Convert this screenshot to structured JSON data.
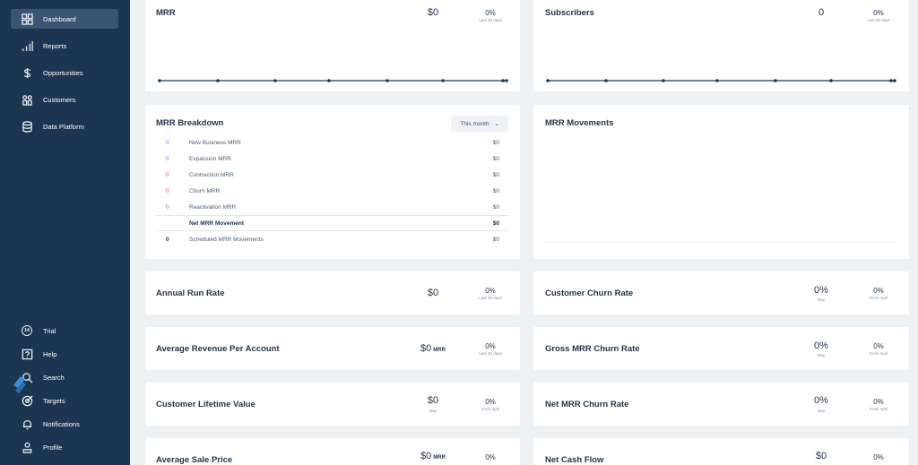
{
  "sidebar": {
    "top_items": [
      {
        "label": "Dashboard",
        "icon": "dashboard-icon",
        "active": true
      },
      {
        "label": "Reports",
        "icon": "bar-chart-icon"
      },
      {
        "label": "Opportunities",
        "icon": "dollar-icon"
      },
      {
        "label": "Customers",
        "icon": "customers-icon"
      },
      {
        "label": "Data Platform",
        "icon": "database-icon"
      }
    ],
    "bottom_items": [
      {
        "label": "Trial",
        "icon": "trial-badge-icon",
        "badge": "14"
      },
      {
        "label": "Help",
        "icon": "help-icon"
      },
      {
        "label": "Search",
        "icon": "search-icon"
      },
      {
        "label": "Targets",
        "icon": "target-icon"
      },
      {
        "label": "Notifications",
        "icon": "bell-icon"
      },
      {
        "label": "Profile",
        "icon": "user-icon"
      }
    ]
  },
  "cards": {
    "mrr": {
      "title": "MRR",
      "value": "$0",
      "pct": "0%",
      "pct_caption": "Last 30 days"
    },
    "subscribers": {
      "title": "Subscribers",
      "value": "0",
      "pct": "0%",
      "pct_caption": "Last 30 days"
    },
    "breakdown": {
      "title": "MRR Breakdown",
      "dropdown": "This month",
      "rows": [
        {
          "count": "0",
          "label": "New Business MRR",
          "amount": "$0"
        },
        {
          "count": "0",
          "label": "Expansion MRR",
          "amount": "$0"
        },
        {
          "count": "0",
          "label": "Contraction MRR",
          "amount": "$0"
        },
        {
          "count": "0",
          "label": "Churn MRR",
          "amount": "$0"
        },
        {
          "count": "0",
          "label": "Reactivation MRR",
          "amount": "$0"
        },
        {
          "count": "",
          "label": "Net MRR Movement",
          "amount": "$0"
        },
        {
          "count": "0",
          "label": "Scheduled MRR Movements",
          "amount": "$0"
        }
      ]
    },
    "movements": {
      "title": "MRR Movements"
    },
    "arr": {
      "title": "Annual Run Rate",
      "value": "$0",
      "pct": "0%",
      "pct_caption": "Last 30 days"
    },
    "cust_churn": {
      "title": "Customer Churn Rate",
      "value": "0%",
      "value_caption": "May",
      "pct": "0%",
      "pct_caption": "From April"
    },
    "arpa": {
      "title": "Average Revenue Per Account",
      "value": "$0",
      "unit": "MRR",
      "pct": "0%",
      "pct_caption": "Last 30 days"
    },
    "gross_churn": {
      "title": "Gross MRR Churn Rate",
      "value": "0%",
      "value_caption": "May",
      "pct": "0%",
      "pct_caption": "From April"
    },
    "ltv": {
      "title": "Customer Lifetime Value",
      "value": "$0",
      "value_caption": "May",
      "pct": "0%",
      "pct_caption": "From April"
    },
    "net_churn": {
      "title": "Net MRR Churn Rate",
      "value": "0%",
      "value_caption": "May",
      "pct": "0%",
      "pct_caption": "From April"
    },
    "asp": {
      "title": "Average Sale Price",
      "value": "$0",
      "unit": "MRR",
      "pct": "0%"
    },
    "cash_flow": {
      "title": "Net Cash Flow",
      "value": "$0",
      "pct": "0%"
    }
  },
  "colors": {
    "sidebar": "#1c3550",
    "active": "#3a5472",
    "line": "#1c3550",
    "blue": "#3d8ed8",
    "red": "#e0466a"
  }
}
